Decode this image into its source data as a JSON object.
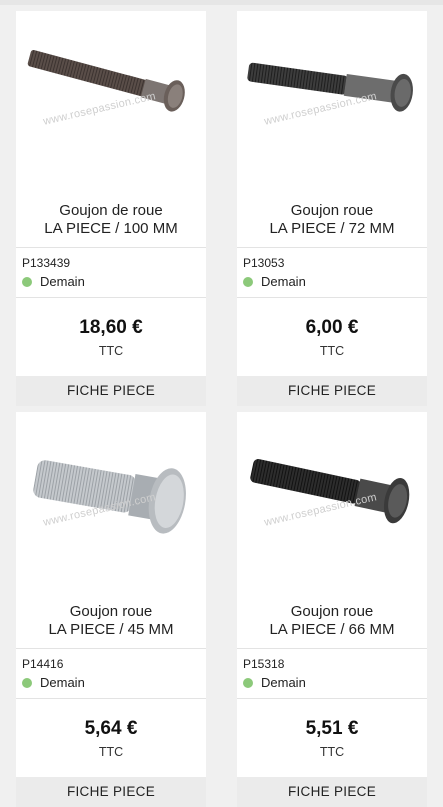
{
  "products": [
    {
      "title_line1": "Goujon de roue",
      "title_line2": "LA PIECE / 100 MM",
      "reference": "P133439",
      "availability": "Demain",
      "price": "18,60 €",
      "tax_label": "TTC",
      "button_label": "FICHE PIECE",
      "watermark": "www.rosepassion.com",
      "image_color": "#5a4e49"
    },
    {
      "title_line1": "Goujon roue",
      "title_line2": "LA PIECE / 72 MM",
      "reference": "P13053",
      "availability": "Demain",
      "price": "6,00 €",
      "tax_label": "TTC",
      "button_label": "FICHE PIECE",
      "watermark": "www.rosepassion.com",
      "image_color": "#3d3d3d"
    },
    {
      "title_line1": "Goujon roue",
      "title_line2": "LA PIECE / 45 MM",
      "reference": "P14416",
      "availability": "Demain",
      "price": "5,64 €",
      "tax_label": "TTC",
      "button_label": "FICHE PIECE",
      "watermark": "www.rosepassion.com",
      "image_color": "#b8bcc0"
    },
    {
      "title_line1": "Goujon roue",
      "title_line2": "LA PIECE / 66 MM",
      "reference": "P15318",
      "availability": "Demain",
      "price": "5,51 €",
      "tax_label": "TTC",
      "button_label": "FICHE PIECE",
      "watermark": "www.rosepassion.com",
      "image_color": "#2d2d2d"
    }
  ],
  "colors": {
    "availability_dot": "#8cc97a",
    "button_bg": "#ebebeb",
    "page_bg": "#f0f0f0"
  }
}
